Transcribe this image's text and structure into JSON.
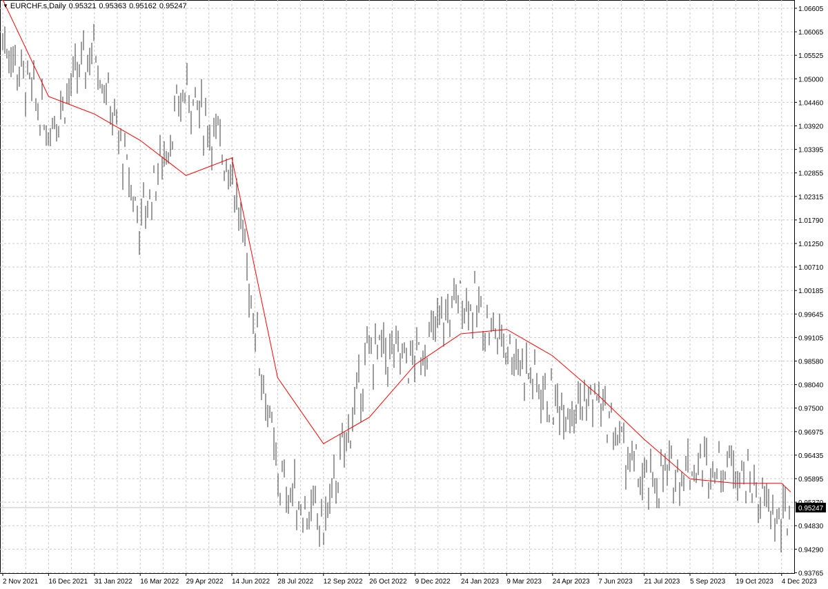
{
  "header": {
    "collapse_icon": "triangle-down-icon",
    "symbol": "EURCHF.s,Daily",
    "open": "0.95321",
    "high": "0.95363",
    "low": "0.95162",
    "close": "0.95247"
  },
  "colors": {
    "background": "#ffffff",
    "grid": "#c8c8c8",
    "bars": "#3a3a3a",
    "moving_average": "#ff0000",
    "current_price_line": "#c0c0c0",
    "price_tag_bg": "#000000",
    "price_tag_text": "#ffffff"
  },
  "chart_data": {
    "type": "ohlc-bar",
    "symbol": "EURCHF.s",
    "timeframe": "Daily",
    "grid": true,
    "price_axis": {
      "position": "right",
      "ticks": [
        "1.06605",
        "1.06065",
        "1.05525",
        "1.05000",
        "1.04460",
        "1.03920",
        "1.03395",
        "1.02855",
        "1.02315",
        "1.01790",
        "1.01250",
        "1.00710",
        "1.00185",
        "0.99645",
        "0.99105",
        "0.98580",
        "0.98040",
        "0.97500",
        "0.96975",
        "0.96435",
        "0.95895",
        "0.95370",
        "0.94830",
        "0.94290",
        "0.93765"
      ],
      "range": [
        0.9363,
        1.0667
      ]
    },
    "time_axis": {
      "position": "bottom",
      "ticks": [
        "2 Nov 2021",
        "16 Dec 2021",
        "31 Jan 2022",
        "16 Mar 2022",
        "29 Apr 2022",
        "14 Jun 2022",
        "28 Jul 2022",
        "12 Sep 2022",
        "26 Oct 2022",
        "9 Dec 2022",
        "24 Jan 2023",
        "9 Mar 2023",
        "24 Apr 2023",
        "7 Jun 2023",
        "21 Jul 2023",
        "5 Sep 2023",
        "19 Oct 2023",
        "4 Dec 2023"
      ]
    },
    "current_price": "0.95247",
    "close_path": [
      {
        "x": "2 Nov 2021",
        "y": 1.0595
      },
      {
        "x": "16 Dec 2021",
        "y": 1.039
      },
      {
        "x": "31 Jan 2022",
        "y": 1.058
      },
      {
        "x": "16 Mar 2022",
        "y": 1.017
      },
      {
        "x": "29 Apr 2022",
        "y": 1.048
      },
      {
        "x": "14 Jun 2022",
        "y": 1.03
      },
      {
        "x": "28 Jul 2022",
        "y": 0.959
      },
      {
        "x": "12 Sep 2022",
        "y": 0.948
      },
      {
        "x": "26 Oct 2022",
        "y": 0.988
      },
      {
        "x": "9 Dec 2022",
        "y": 0.986
      },
      {
        "x": "24 Jan 2023",
        "y": 1.001
      },
      {
        "x": "9 Mar 2023",
        "y": 0.99
      },
      {
        "x": "24 Apr 2023",
        "y": 0.976
      },
      {
        "x": "7 Jun 2023",
        "y": 0.977
      },
      {
        "x": "21 Jul 2023",
        "y": 0.957
      },
      {
        "x": "5 Sep 2023",
        "y": 0.962
      },
      {
        "x": "19 Oct 2023",
        "y": 0.963
      },
      {
        "x": "4 Dec 2023",
        "y": 0.948
      },
      {
        "x": "end",
        "y": 0.9525
      }
    ],
    "moving_average": {
      "color": "#ff0000",
      "points": [
        {
          "x": "2 Nov 2021",
          "y": 1.068
        },
        {
          "x": "16 Dec 2021",
          "y": 1.046
        },
        {
          "x": "31 Jan 2022",
          "y": 1.042
        },
        {
          "x": "16 Mar 2022",
          "y": 1.036
        },
        {
          "x": "29 Apr 2022",
          "y": 1.028
        },
        {
          "x": "14 Jun 2022",
          "y": 1.032
        },
        {
          "x": "28 Jul 2022",
          "y": 0.982
        },
        {
          "x": "12 Sep 2022",
          "y": 0.967
        },
        {
          "x": "26 Oct 2022",
          "y": 0.973
        },
        {
          "x": "9 Dec 2022",
          "y": 0.985
        },
        {
          "x": "24 Jan 2023",
          "y": 0.992
        },
        {
          "x": "9 Mar 2023",
          "y": 0.993
        },
        {
          "x": "24 Apr 2023",
          "y": 0.987
        },
        {
          "x": "7 Jun 2023",
          "y": 0.978
        },
        {
          "x": "21 Jul 2023",
          "y": 0.968
        },
        {
          "x": "5 Sep 2023",
          "y": 0.959
        },
        {
          "x": "19 Oct 2023",
          "y": 0.958
        },
        {
          "x": "4 Dec 2023",
          "y": 0.958
        },
        {
          "x": "end",
          "y": 0.956
        }
      ]
    }
  }
}
